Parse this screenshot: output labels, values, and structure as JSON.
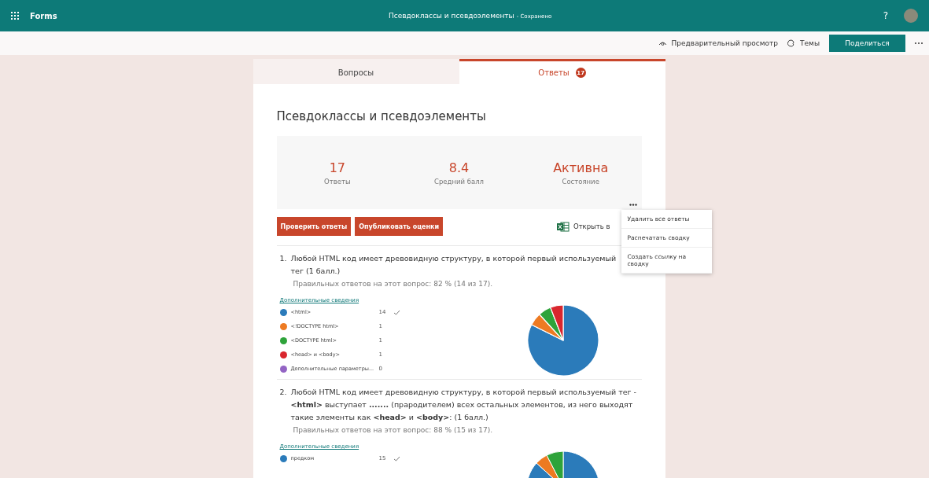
{
  "app_bar": {
    "app_name": "Forms",
    "title": "Псевдоклассы и псевдоэлементы",
    "save_status": "- Сохранено",
    "help": "?"
  },
  "toolbar": {
    "preview": "Предварительный просмотр",
    "themes": "Темы",
    "share": "Поделиться"
  },
  "tabs": [
    {
      "label": "Вопросы",
      "selected": false
    },
    {
      "label": "Ответы",
      "selected": true,
      "badge": "17"
    }
  ],
  "form_title": "Псевдоклассы и псевдоэлементы",
  "stats": [
    {
      "value": "17",
      "label": "Ответы"
    },
    {
      "value": "8.4",
      "label": "Средний балл"
    },
    {
      "value": "Активна",
      "label": "Состояние"
    }
  ],
  "actions": [
    "Проверить ответы",
    "Опубликовать оценки"
  ],
  "open_excel": "Открыть в",
  "more_menu": {
    "expanded": true,
    "items": [
      "Удалить все ответы",
      "Распечатать сводку",
      "Создать ссылку на сводку"
    ]
  },
  "questions": [
    {
      "number": "1.",
      "text": "Любой HTML код имеет древовидную структуру, в которой первый используемый тег (1 балл.)",
      "summary": "Правильных ответов на этот вопрос: 82 % (14 из 17).",
      "details": "Дополнительные сведения",
      "options": [
        {
          "label": "<html>",
          "count": "14",
          "correct": true,
          "color": "#2b7bba"
        },
        {
          "label": "<!DOCTYPE html>",
          "count": "1",
          "correct": false,
          "color": "#ed7a22"
        },
        {
          "label": "<DOCTYPE html>",
          "count": "1",
          "correct": false,
          "color": "#2ea33a"
        },
        {
          "label": "<head> и <body>",
          "count": "1",
          "correct": false,
          "color": "#d9272e"
        },
        {
          "label": "Дополнительные параметры...",
          "count": "0",
          "correct": false,
          "color": "#9364c4"
        }
      ],
      "chart_data": {
        "type": "pie",
        "values": [
          82.35,
          5.88,
          5.88,
          5.89,
          0
        ]
      }
    },
    {
      "number": "2.",
      "text": "Любой HTML код имеет древовидную структуру, в которой первый используемый тег - **<html>** выступает **.......** (прародителем) всех остальных элементов, из него выходят такие элементы как **<head>** и **<body>**: (1 балл.)",
      "summary": "Правильных ответов на этот вопрос: 88 % (15 из 17).",
      "details": "Дополнительные сведения",
      "options": [
        {
          "label": "предком",
          "count": "15",
          "correct": true,
          "color": "#2b7bba"
        }
      ]
    }
  ]
}
